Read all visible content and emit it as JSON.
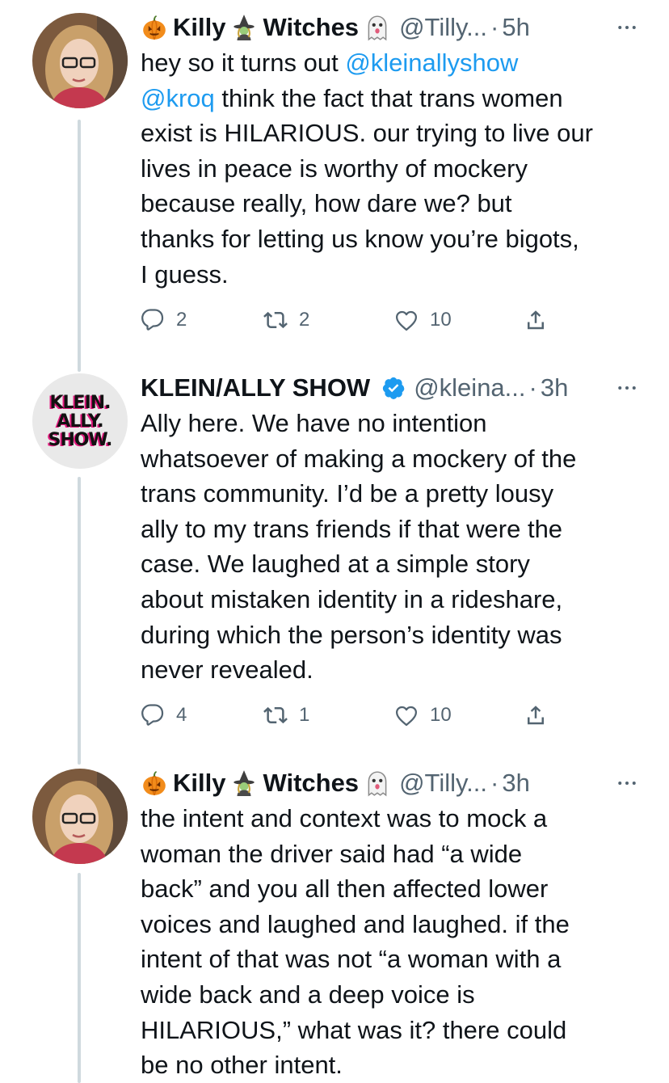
{
  "tweets": [
    {
      "name_a": "Killy",
      "name_b": "Witches",
      "handle": "@Tilly...",
      "time": "5h",
      "text_parts": [
        {
          "t": "hey so it turns out "
        },
        {
          "t": "@kleinallyshow",
          "m": true
        },
        {
          "t": "\n"
        },
        {
          "t": "@kroq",
          "m": true
        },
        {
          "t": " think the fact that trans women\nexist is HILARIOUS. our trying to live our\nlives in peace is worthy of mockery\nbecause really, how dare we? but\nthanks for letting us know you’re bigots,\nI guess."
        }
      ],
      "replies": "2",
      "retweets": "2",
      "likes": "10"
    },
    {
      "name": "KLEIN/ALLY SHOW",
      "handle": "@kleina...",
      "time": "3h",
      "avatar_text": [
        "KLEIN.",
        "ALLY.",
        "SHOW."
      ],
      "text": "Ally here. We have no intention\nwhatsoever of making a mockery of the\ntrans community. I’d be a pretty lousy\nally to my trans friends if that were the\ncase. We laughed at a simple story\nabout mistaken identity in a rideshare,\nduring which the person’s identity was\nnever revealed.",
      "replies": "4",
      "retweets": "1",
      "likes": "10"
    },
    {
      "name_a": "Killy",
      "name_b": "Witches",
      "handle": "@Tilly...",
      "time": "3h",
      "text": "the intent and context was to mock a\nwoman the driver said had “a wide\nback” and you all then affected lower\nvoices and laughed and laughed. if the\nintent of that was not “a woman with a\nwide back and a deep voice is\nHILARIOUS,” what was it? there could\nbe no other intent."
    }
  ],
  "icons": {
    "separator": "·",
    "pumpkin": "pumpkin-icon",
    "witch": "witch-icon",
    "ghost": "ghost-icon",
    "verified": "verified-badge-icon",
    "more": "more-icon",
    "reply": "reply-icon",
    "retweet": "retweet-icon",
    "like": "like-icon",
    "share": "share-icon"
  },
  "colors": {
    "link": "#1d9bf0",
    "secondary": "#536471",
    "thread_line": "#cfd9de"
  }
}
